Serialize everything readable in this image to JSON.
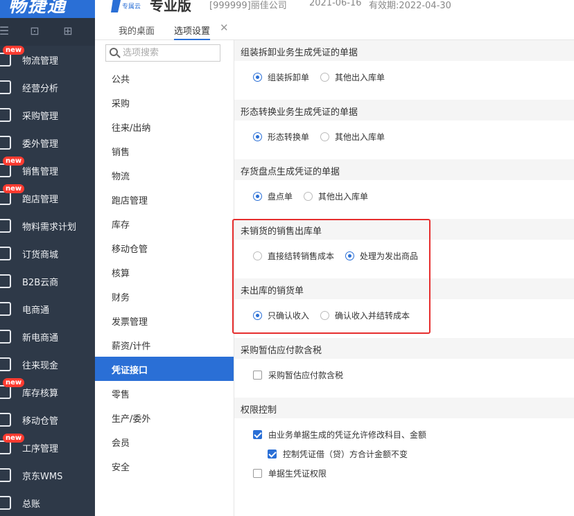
{
  "header": {
    "brand": "畅捷通",
    "product_sub": "专属云",
    "product_name": "专业版",
    "company": "[999999]丽佳公司",
    "date": "2021-06-16",
    "validity": "有效期:2022-04-30"
  },
  "nav": {
    "badge": "new",
    "items": [
      {
        "label": "物流管理",
        "new": true
      },
      {
        "label": "经营分析",
        "new": false
      },
      {
        "label": "采购管理",
        "new": false
      },
      {
        "label": "委外管理",
        "new": false
      },
      {
        "label": "销售管理",
        "new": true
      },
      {
        "label": "跑店管理",
        "new": true
      },
      {
        "label": "物料需求计划",
        "new": false
      },
      {
        "label": "订货商城",
        "new": false
      },
      {
        "label": "B2B云商",
        "new": false
      },
      {
        "label": "电商通",
        "new": false
      },
      {
        "label": "新电商通",
        "new": false
      },
      {
        "label": "往来现金",
        "new": false
      },
      {
        "label": "库存核算",
        "new": true
      },
      {
        "label": "移动仓管",
        "new": false
      },
      {
        "label": "工序管理",
        "new": true
      },
      {
        "label": "京东WMS",
        "new": false
      },
      {
        "label": "总账",
        "new": false
      }
    ]
  },
  "tabs": [
    {
      "label": "我的桌面"
    },
    {
      "label": "选项设置",
      "active": true
    }
  ],
  "search": {
    "placeholder": "选项搜索"
  },
  "categories": [
    "公共",
    "采购",
    "往来/出纳",
    "销售",
    "物流",
    "跑店管理",
    "库存",
    "移动仓管",
    "核算",
    "财务",
    "发票管理",
    "薪资/计件",
    "凭证接口",
    "零售",
    "生产/委外",
    "会员",
    "安全"
  ],
  "active_category": "凭证接口",
  "sections": {
    "s1": {
      "title": "组装拆卸业务生成凭证的单据",
      "opt1": "组装拆卸单",
      "opt2": "其他出入库单"
    },
    "s2": {
      "title": "形态转换业务生成凭证的单据",
      "opt1": "形态转换单",
      "opt2": "其他出入库单"
    },
    "s3": {
      "title": "存货盘点生成凭证的单据",
      "opt1": "盘点单",
      "opt2": "其他出入库单"
    },
    "s4": {
      "title": "未销货的销售出库单",
      "opt1": "直接结转销售成本",
      "opt2": "处理为发出商品"
    },
    "s5": {
      "title": "未出库的销货单",
      "opt1": "只确认收入",
      "opt2": "确认收入并结转成本"
    },
    "s6": {
      "title": "采购暂估应付款含税",
      "opt1": "采购暂估应付款含税"
    },
    "s7": {
      "title": "权限控制",
      "opt1": "由业务单据生成的凭证允许修改科目、金额",
      "opt2": "控制凭证借（贷）方合计金额不变",
      "opt3": "单据生凭证权限"
    }
  },
  "colors": {
    "accent": "#2a6fd6",
    "nav_bg": "#2e3948",
    "highlight": "#e62e2e",
    "badge": "#ff3b30"
  }
}
